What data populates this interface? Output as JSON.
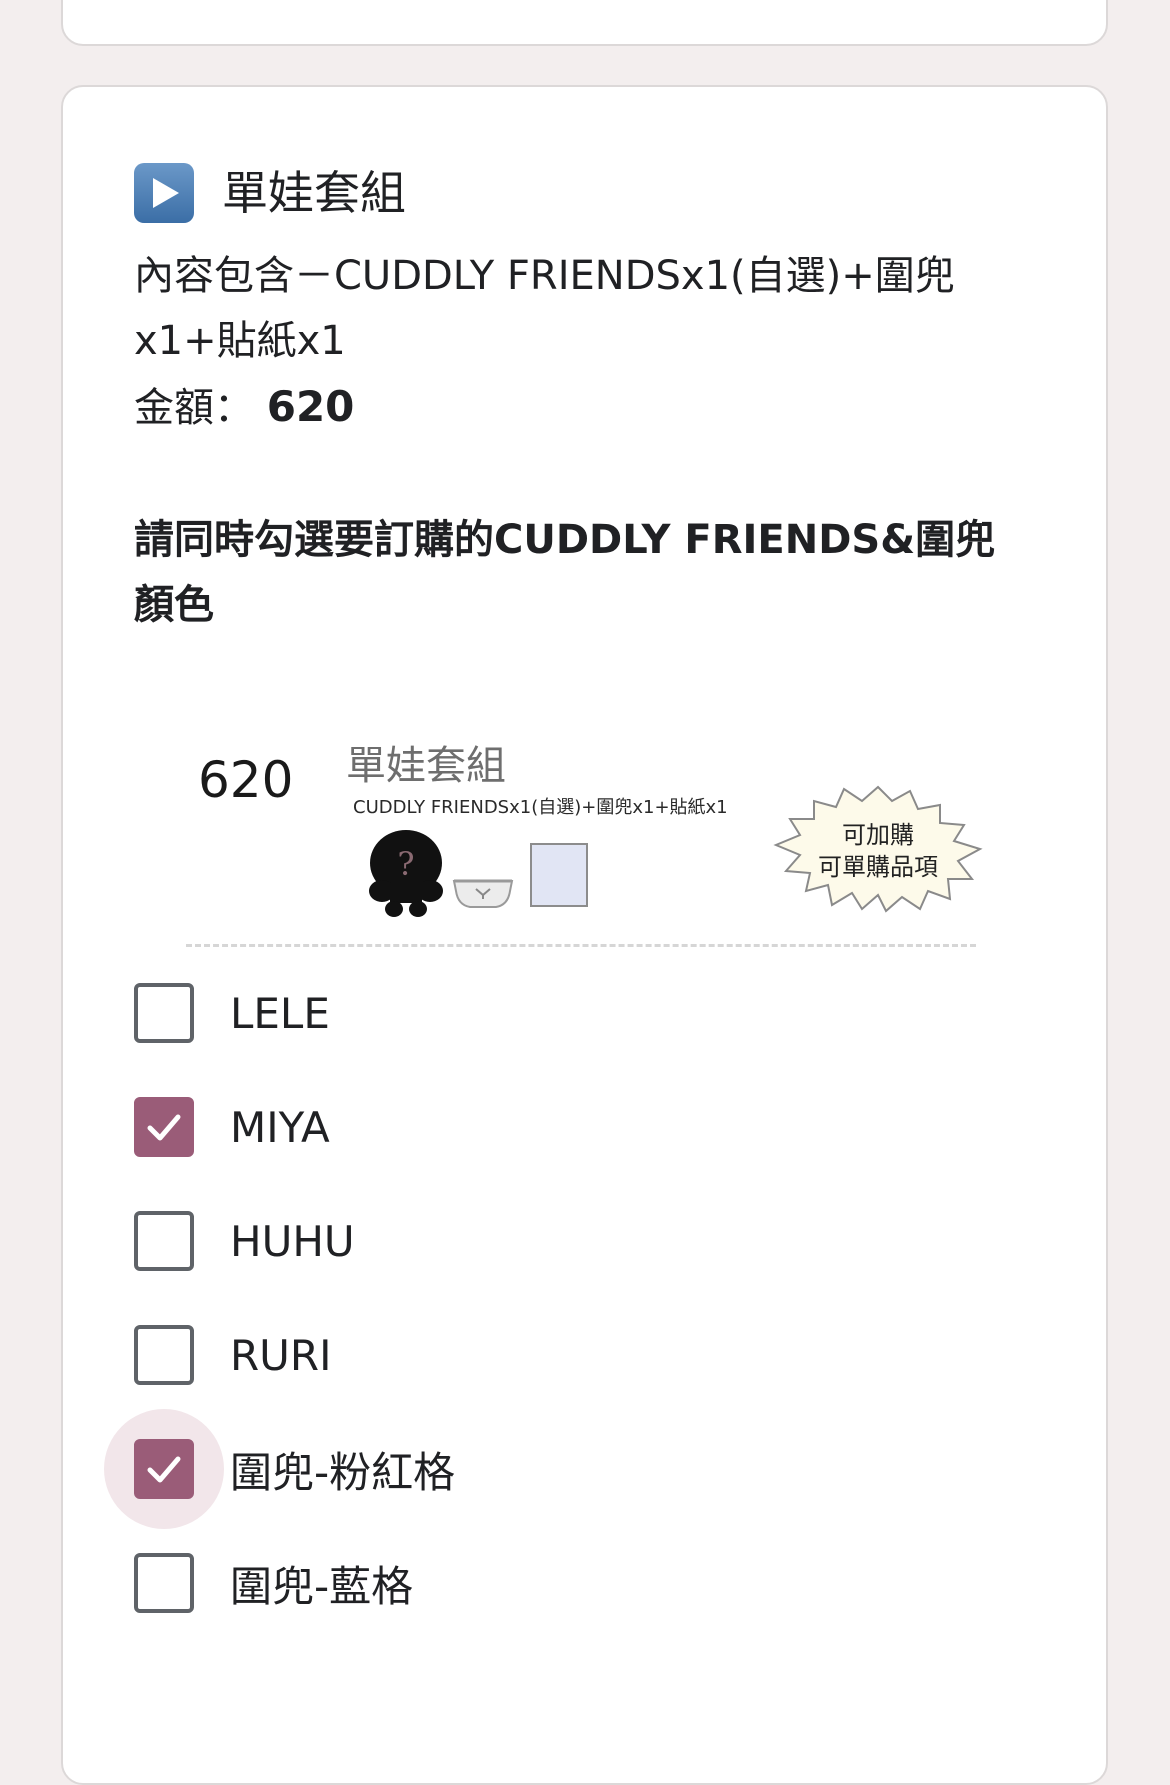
{
  "section": {
    "title": "單娃套組",
    "description_line1": "內容包含－CUDDLY FRIENDSx1(自選)+圍兜x1+貼紙x1",
    "price_label": "金額：",
    "price_value": "620",
    "instruction": "請同時勾選要訂購的CUDDLY FRIENDS&圍兜顏色"
  },
  "product_image": {
    "price": "620",
    "title": "單娃套組",
    "subtitle": "CUDDLY FRIENDSx1(自選)+圍兜x1+貼紙x1",
    "badge_line1": "可加購",
    "badge_line2": "可單購品項",
    "doll_mark": "?"
  },
  "options": [
    {
      "label": "LELE",
      "checked": false
    },
    {
      "label": "MIYA",
      "checked": true
    },
    {
      "label": "HUHU",
      "checked": false
    },
    {
      "label": "RURI",
      "checked": false
    },
    {
      "label": "圍兜-粉紅格",
      "checked": true
    },
    {
      "label": "圍兜-藍格",
      "checked": false
    }
  ],
  "colors": {
    "accent": "#9a5c78",
    "play_icon": "#4a7bb2",
    "background": "#f3eeee"
  }
}
